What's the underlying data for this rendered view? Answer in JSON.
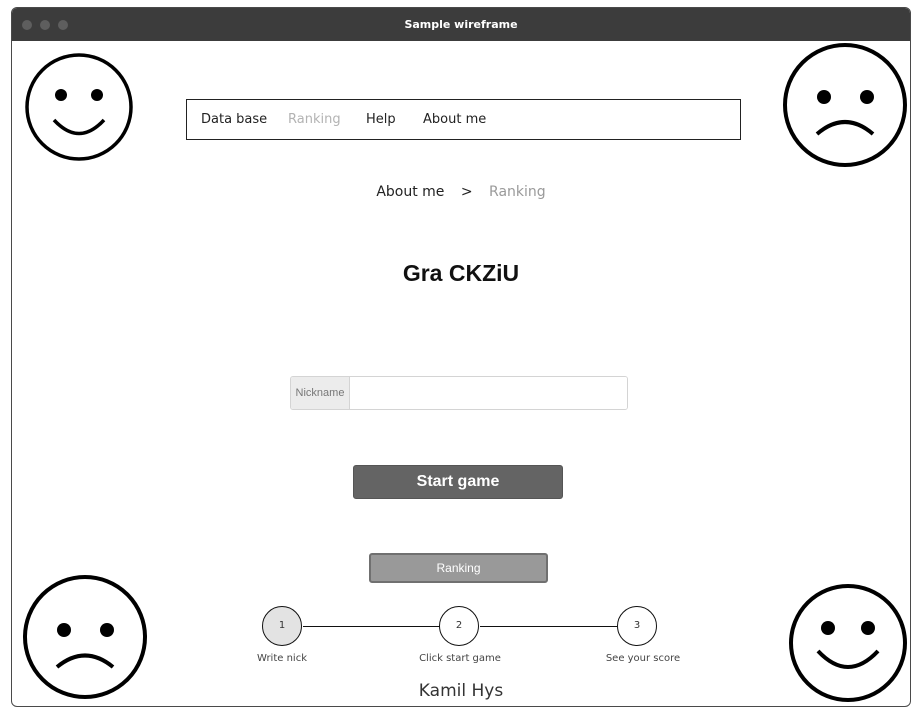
{
  "window": {
    "title": "Sample wireframe"
  },
  "nav": {
    "items": [
      {
        "label": "Data base",
        "state": "normal"
      },
      {
        "label": "Ranking",
        "state": "disabled"
      },
      {
        "label": "Help",
        "state": "normal"
      },
      {
        "label": "About me",
        "state": "normal"
      }
    ]
  },
  "breadcrumb": {
    "parent": "About me",
    "separator": ">",
    "current": "Ranking"
  },
  "page": {
    "heading": "Gra CKZiU"
  },
  "form": {
    "nickname_label": "Nickname",
    "nickname_value": "",
    "nickname_placeholder": "",
    "start_label": "Start game",
    "ranking_label": "Ranking"
  },
  "stepper": {
    "steps": [
      {
        "number": "1",
        "label": "Write nick",
        "active": true
      },
      {
        "number": "2",
        "label": "Click start game",
        "active": false
      },
      {
        "number": "3",
        "label": "See your score",
        "active": false
      }
    ]
  },
  "footer": {
    "author": "Kamil Hys"
  },
  "decorations": {
    "faces": [
      "smile-face-icon",
      "frown-face-icon",
      "frown-face-icon",
      "smile-face-icon"
    ]
  },
  "colors": {
    "titlebar": "#3c3c3c",
    "primary_button": "#646464",
    "secondary_button": "#999999",
    "disabled_text": "#b3b3b3"
  }
}
